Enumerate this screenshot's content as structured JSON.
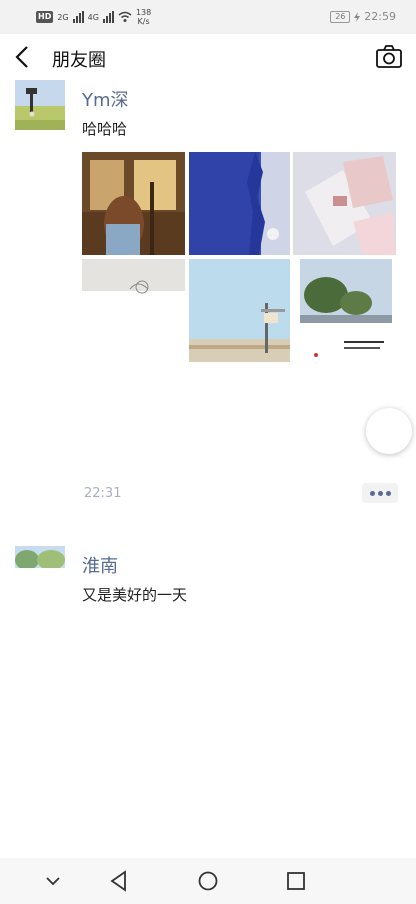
{
  "status_bar": {
    "left_badge": "HD",
    "net1": "2G",
    "net2": "4G",
    "speed_value": "138",
    "speed_unit": "K/s",
    "battery": "26",
    "time": "22:59"
  },
  "header": {
    "title": "朋友圈",
    "back_icon": "chevron-left-icon",
    "camera_icon": "camera-icon"
  },
  "posts": [
    {
      "name": "Ym深",
      "text": "哈哈哈",
      "time": "22:31",
      "photos": [
        {
          "desc": "train-window"
        },
        {
          "desc": "blue-wall"
        },
        {
          "desc": "cards"
        },
        {
          "desc": "sketch"
        },
        {
          "desc": "sky-sign"
        },
        {
          "desc": "trees"
        }
      ]
    },
    {
      "name": "淮南",
      "text": "又是美好的一天"
    }
  ],
  "colors": {
    "name_link": "#576b95",
    "time_text": "#a8b0c0"
  },
  "nav_bar": {
    "icons": [
      "chevron-down-icon",
      "back-triangle-icon",
      "home-circle-icon",
      "recents-square-icon"
    ]
  }
}
